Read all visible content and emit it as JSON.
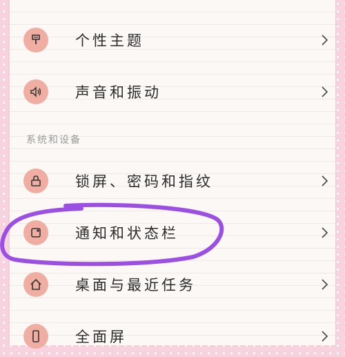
{
  "colors": {
    "icon_bg": "#f0aea3",
    "highlight": "#9b4fe3",
    "border_pink": "#f7d2df"
  },
  "section": {
    "system_devices": "系统和设备"
  },
  "items": [
    {
      "label": "个性主题",
      "icon": "brush-icon"
    },
    {
      "label": "声音和振动",
      "icon": "speaker-icon"
    },
    {
      "label": "锁屏、密码和指纹",
      "icon": "lock-icon"
    },
    {
      "label": "通知和状态栏",
      "icon": "notification-icon"
    },
    {
      "label": "桌面与最近任务",
      "icon": "home-icon"
    },
    {
      "label": "全面屏",
      "icon": "phone-icon"
    }
  ]
}
